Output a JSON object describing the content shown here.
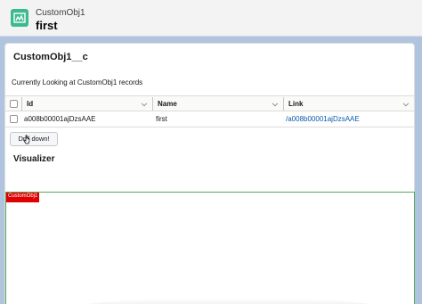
{
  "header": {
    "object_type": "CustomObj1",
    "record_name": "first",
    "icon": "custom-object-icon",
    "icon_color": "#3bba8e"
  },
  "card": {
    "title": "CustomObj1__c",
    "subtitle": "Currently Looking at CustomObj1 records"
  },
  "table": {
    "columns": [
      {
        "label": "Id"
      },
      {
        "label": "Name"
      },
      {
        "label": "Link"
      }
    ],
    "rows": [
      {
        "id": "a008b00001ajDzsAAE",
        "name": "first",
        "link": "/a008b00001ajDzsAAE"
      }
    ]
  },
  "button": {
    "label": "Drill down!"
  },
  "visualizer": {
    "title": "Visualizer",
    "node_label": "CustomObj1",
    "node_color": "#e00000",
    "frame_color": "#5aa85a"
  },
  "colors": {
    "page_background": "#b0c4df",
    "link": "#0b5cab"
  }
}
